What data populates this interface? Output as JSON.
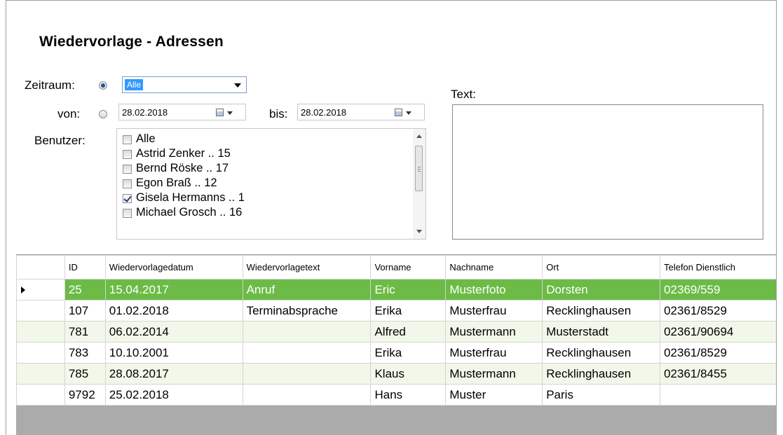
{
  "title": "Wiedervorlage - Adressen",
  "filters": {
    "zeitraum_label": "Zeitraum:",
    "zeitraum_value": "Alle",
    "von_label": "von:",
    "von_date": "28.02.2018",
    "bis_label": "bis:",
    "bis_date": "28.02.2018",
    "benutzer_label": "Benutzer:",
    "text_label": "Text:"
  },
  "users": [
    {
      "label": "Alle",
      "checked": false
    },
    {
      "label": "Astrid Zenker .. 15",
      "checked": false
    },
    {
      "label": "Bernd Röske .. 17",
      "checked": false
    },
    {
      "label": "Egon Braß .. 12",
      "checked": false
    },
    {
      "label": "Gisela Hermanns .. 1",
      "checked": true
    },
    {
      "label": "Michael Grosch .. 16",
      "checked": false
    }
  ],
  "grid": {
    "columns": [
      "ID",
      "Wiedervorlagedatum",
      "Wiedervorlagetext",
      "Vorname",
      "Nachname",
      "Ort",
      "Telefon Dienstlich"
    ],
    "rows": [
      [
        "25",
        "15.04.2017",
        "Anruf",
        "Eric",
        "Musterfoto",
        "Dorsten",
        "02369/559"
      ],
      [
        "107",
        "01.02.2018",
        "Terminabsprache",
        "Erika",
        "Musterfrau",
        "Recklinghausen",
        "02361/8529"
      ],
      [
        "781",
        "06.02.2014",
        "",
        "Alfred",
        "Mustermann",
        "Musterstadt",
        "02361/90694"
      ],
      [
        "783",
        "10.10.2001",
        "",
        "Erika",
        "Musterfrau",
        "Recklinghausen",
        "02361/8529"
      ],
      [
        "785",
        "28.08.2017",
        "",
        "Klaus",
        "Mustermann",
        "Recklinghausen",
        "02361/8455"
      ],
      [
        "9792",
        "25.02.2018",
        "",
        "Hans",
        "Muster",
        "Paris",
        ""
      ]
    ],
    "selected_row": 0
  },
  "colors": {
    "selected_row": "#6bbb46",
    "alt_row": "#f1f8e9",
    "grid_background": "#ababab",
    "combo_highlight": "#3399ff"
  }
}
